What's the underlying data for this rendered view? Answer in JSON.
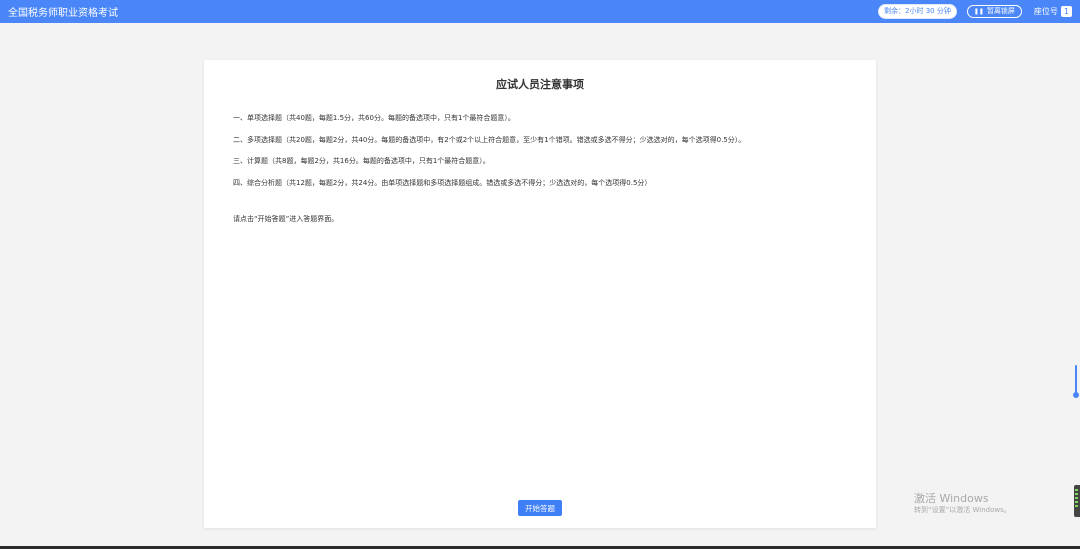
{
  "header": {
    "app_title": "全国税务师职业资格考试",
    "timer": "剩余：2小时 30 分钟",
    "pause_label": "暂离锁屏",
    "seat_label": "座位号",
    "seat_number": "1"
  },
  "notice": {
    "title": "应试人员注意事项",
    "rules": [
      "一、单项选择题（共40题，每题1.5分，共60分。每题的备选项中，只有1个最符合题意）。",
      "二、多项选择题（共20题，每题2分，共40分。每题的备选项中，有2个或2个以上符合题意，至少有1个错项。错选或多选不得分；少选选对的，每个选项得0.5分）。",
      "三、计算题（共8题，每题2分，共16分。每题的备选项中，只有1个最符合题意）。",
      "四、综合分析题（共12题，每题2分，共24分。由单项选择题和多项选择题组成。错选或多选不得分；少选选对的，每个选项得0.5分）"
    ],
    "hint": "请点击“开始答题”进入答题界面。",
    "start_label": "开始答题"
  },
  "watermark": {
    "title": "激活 Windows",
    "subtitle": "转到“设置”以激活 Windows。"
  },
  "colors": {
    "accent": "#4a86f7",
    "button": "#3e7ef6"
  }
}
